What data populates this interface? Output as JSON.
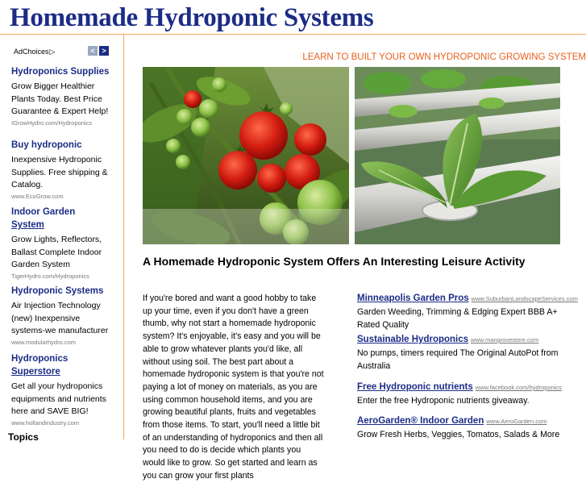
{
  "header": {
    "site_title": "Homemade Hydroponic Systems",
    "tagline": "LEARN TO BUILT YOUR OWN HYDROPONIC GROWING SYSTEM"
  },
  "colors": {
    "title_blue": "#1c2c86",
    "tagline_orange": "#e8601c",
    "rule_orange": "#f0a858",
    "url_gray": "#777777"
  },
  "sidebar": {
    "adchoices_label": "AdChoices",
    "adchoices_icon": "play-triangle-icon",
    "prev_icon": "chevron-left-icon",
    "next_icon": "chevron-right-icon",
    "ads": [
      {
        "title": "Hydroponics Supplies",
        "desc": "Grow Bigger Healthier Plants Today. Best Price Guarantee & Expert Help!",
        "url": "IGrowHydro.com/Hydroponics"
      },
      {
        "title": "Buy hydroponic",
        "desc": "Inexpensive Hydroponic Supplies. Free shipping & Catalog.",
        "url": "www.EcoGrow.com"
      },
      {
        "title_line1": "Indoor Garden",
        "title_line2": "System",
        "desc": "Grow Lights, Reflectors, Ballast Complete Indoor Garden System",
        "url": "TigerHydro.com/Hydroponics"
      },
      {
        "title": "Hydroponic Systems",
        "desc": "Air Injection Technology (new) Inexpensive systems-we manufacturer",
        "url": "www.modularhydro.com"
      },
      {
        "title_line1": "Hydroponics",
        "title_line2": "Superstore",
        "desc": "Get all your hydroponics equipments and nutrients here and SAVE BIG!",
        "url": "www.hollandindustry.com"
      }
    ],
    "topics_heading": "Topics"
  },
  "article": {
    "title": "A Homemade Hydroponic System Offers An Interesting Leisure Activity",
    "body": "If you're bored and want a good hobby to take up your time, even if you don't have a green thumb, why not start a homemade hydroponic system? It's enjoyable, it's easy and you will be able to grow whatever plants you'd like, all without using soil. The best part about a homemade hydroponic system is that you're not paying a lot of money on materials, as you are using common household items, and you are growing beautiful plants, fruits and vegetables from those items. To start, you'll need a little bit of an understanding of hydroponics and then all you need to do is decide which plants you would like to grow. So get started and learn as you can grow your first plants"
  },
  "right_ads": [
    {
      "title": "Minneapolis Garden Pros",
      "url": "www.SuburbanLandscapeServices.com",
      "desc": "Garden Weeding, Trimming & Edging Expert BBB A+ Rated Quality"
    },
    {
      "title": "Sustainable Hydroponics",
      "url": "www.mangrovestore.com",
      "desc": "No pumps, timers required The Original AutoPot from Australia"
    },
    {
      "title": "Free Hydroponic nutrients",
      "url": "www.facebook.com/hydroponics",
      "desc": "Enter the free Hydroponic nutrients giveaway."
    },
    {
      "title": "AeroGarden® Indoor Garden",
      "url": "www.AeroGarden.com",
      "desc": "Grow Fresh Herbs, Veggies, Tomatos, Salads & More"
    }
  ]
}
